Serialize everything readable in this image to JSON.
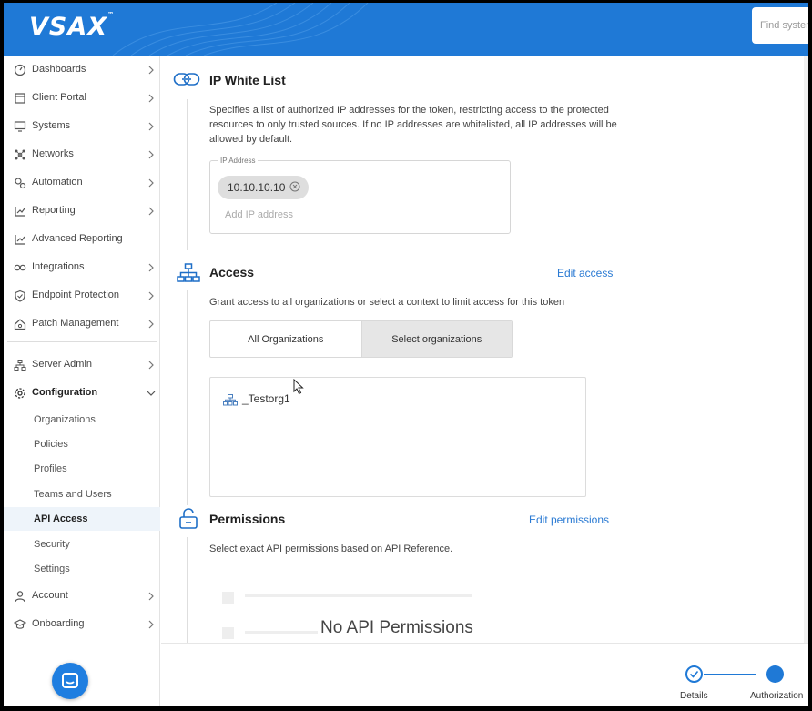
{
  "app": {
    "logo": "VSAX",
    "logo_mark": "™",
    "search_placeholder": "Find systems",
    "brand_color": "#1f79d6"
  },
  "sidebar": {
    "items": [
      {
        "label": "Dashboards",
        "icon": "dashboard-icon"
      },
      {
        "label": "Client Portal",
        "icon": "portal-icon"
      },
      {
        "label": "Systems",
        "icon": "monitor-icon"
      },
      {
        "label": "Networks",
        "icon": "network-icon"
      },
      {
        "label": "Automation",
        "icon": "gears-icon"
      },
      {
        "label": "Reporting",
        "icon": "chart-icon"
      },
      {
        "label": "Advanced Reporting",
        "icon": "chart-icon"
      },
      {
        "label": "Integrations",
        "icon": "infinity-icon"
      },
      {
        "label": "Endpoint Protection",
        "icon": "shield-icon"
      },
      {
        "label": "Patch Management",
        "icon": "house-gear-icon"
      }
    ],
    "server_admin": "Server Admin",
    "configuration": "Configuration",
    "config_children": [
      "Organizations",
      "Policies",
      "Profiles",
      "Teams and Users",
      "API Access",
      "Security",
      "Settings"
    ],
    "active_child": "API Access",
    "account": "Account",
    "onboarding": "Onboarding"
  },
  "ip_whitelist": {
    "title": "IP White List",
    "description": "Specifies a list of authorized IP addresses for the token, restricting access to the protected resources to only trusted sources. If no IP addresses are whitelisted, all IP addresses will be allowed by default.",
    "field_label": "IP Address",
    "chip": "10.10.10.10",
    "placeholder": "Add IP address"
  },
  "access": {
    "title": "Access",
    "edit": "Edit access",
    "description": "Grant access to all organizations or select a context to limit access for this token",
    "tabs": [
      "All Organizations",
      "Select organizations"
    ],
    "selected_tab": "Select organizations",
    "org": "_Testorg1"
  },
  "permissions": {
    "title": "Permissions",
    "edit": "Edit permissions",
    "description": "Select exact API permissions based on API Reference.",
    "empty": "No API Permissions"
  },
  "stepper": {
    "steps": [
      "Details",
      "Authorization"
    ],
    "current": "Authorization"
  }
}
